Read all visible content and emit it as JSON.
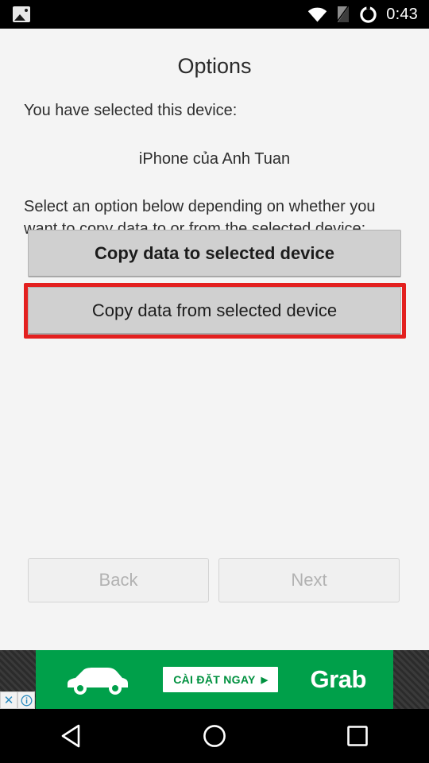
{
  "status_bar": {
    "notification_icon": "photo-icon",
    "wifi_icon": "wifi-icon",
    "sim_icon": "sim-no-signal-icon",
    "battery_icon": "battery-circle-icon",
    "time": "0:43"
  },
  "page": {
    "title": "Options",
    "intro_text": "You have selected this device:",
    "device_name": "iPhone của Anh Tuan",
    "instruction_text": "Select an option below depending on whether you want to copy data to or from the selected device:"
  },
  "options": {
    "copy_to_label": "Copy data to selected device",
    "copy_from_label": "Copy data from selected device",
    "highlight_color": "#e3201f"
  },
  "wizard_nav": {
    "back_label": "Back",
    "next_label": "Next"
  },
  "ad": {
    "cta_label": "CÀI ĐẶT NGAY",
    "cta_arrow": "▶",
    "brand": "Grab",
    "car_icon": "car-icon",
    "close_icon": "✕",
    "info_icon": "i",
    "background_color": "#00a04a"
  },
  "system_nav": {
    "back": "back-triangle-icon",
    "home": "home-circle-icon",
    "recents": "recents-square-icon"
  }
}
